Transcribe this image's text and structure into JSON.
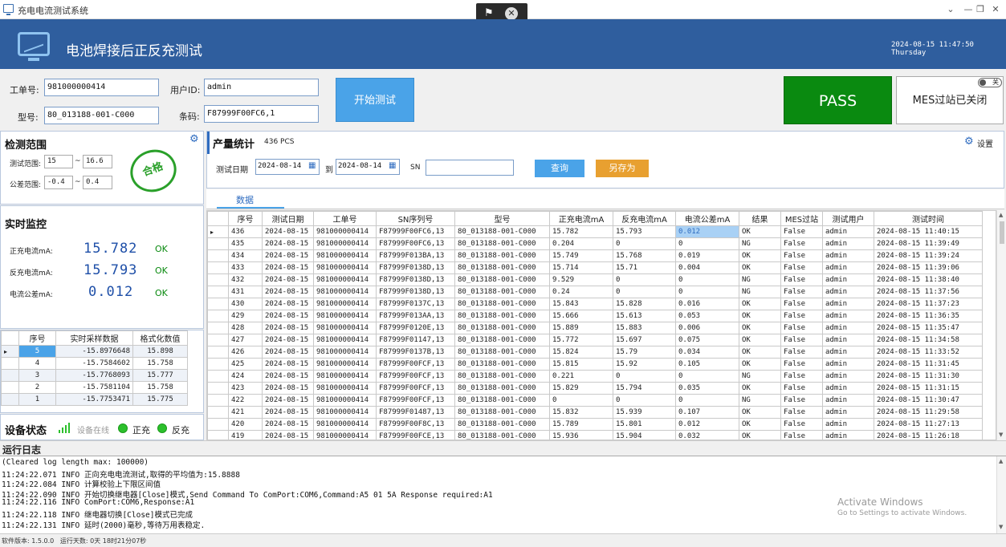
{
  "window": {
    "title": "充电电流测试系统"
  },
  "header": {
    "title": "电池焊接后正反充测试",
    "datetime": "2024-08-15 11:47:50 Thursday"
  },
  "form": {
    "work_order_label": "工单号:",
    "work_order": "981000000414",
    "model_label": "型号:",
    "model": "80_013188-001-C000",
    "user_label": "用户ID:",
    "user": "admin",
    "barcode_label": "条码:",
    "barcode": "F87999F00FC6,1",
    "start_button": "开始测试",
    "result": "PASS",
    "mes_status": "MES过站已关闭",
    "mes_toggle": "关"
  },
  "range": {
    "title": "检测范围",
    "test_range_label": "测试范围:",
    "test_min": "15",
    "test_max": "16.6",
    "tol_label": "公差范围:",
    "tol_min": "-0.4",
    "tol_max": "0.4",
    "stamp_text": "合格"
  },
  "monitor": {
    "title": "实时监控",
    "rows": [
      {
        "label": "正充电流mA:",
        "value": "15.782",
        "status": "OK"
      },
      {
        "label": "反充电流mA:",
        "value": "15.793",
        "status": "OK"
      },
      {
        "label": "电流公差mA:",
        "value": "0.012",
        "status": "OK"
      }
    ]
  },
  "samples": {
    "headers": [
      "序号",
      "实时采样数据",
      "格式化数值"
    ],
    "rows": [
      [
        "5",
        "-15.8976648",
        "15.898"
      ],
      [
        "4",
        "-15.7584602",
        "15.758"
      ],
      [
        "3",
        "-15.7768093",
        "15.777"
      ],
      [
        "2",
        "-15.7581104",
        "15.758"
      ],
      [
        "1",
        "-15.7753471",
        "15.775"
      ]
    ]
  },
  "device": {
    "title": "设备状态",
    "online": "设备在线",
    "forward": "正充",
    "reverse": "反充"
  },
  "stats": {
    "title": "产量统计",
    "count": "436 PCS",
    "settings": "设置",
    "date_label": "测试日期",
    "date_from": "2024-08-14",
    "to_label": "到",
    "date_to": "2024-08-14",
    "sn_label": "SN",
    "sn_value": "",
    "query_button": "查询",
    "save_button": "另存为",
    "tab": "数据"
  },
  "grid": {
    "headers": [
      "序号",
      "测试日期",
      "工单号",
      "SN序列号",
      "型号",
      "正充电流mA",
      "反充电流mA",
      "电流公差mA",
      "结果",
      "MES过站",
      "测试用户",
      "测试时间"
    ],
    "rows": [
      [
        "436",
        "2024-08-15",
        "981000000414",
        "F87999F00FC6,13",
        "80_013188-001-C000",
        "15.782",
        "15.793",
        "0.012",
        "OK",
        "False",
        "admin",
        "2024-08-15 11:40:15"
      ],
      [
        "435",
        "2024-08-15",
        "981000000414",
        "F87999F00FC6,13",
        "80_013188-001-C000",
        "0.204",
        "0",
        "0",
        "NG",
        "False",
        "admin",
        "2024-08-15 11:39:49"
      ],
      [
        "434",
        "2024-08-15",
        "981000000414",
        "F87999F013BA,13",
        "80_013188-001-C000",
        "15.749",
        "15.768",
        "0.019",
        "OK",
        "False",
        "admin",
        "2024-08-15 11:39:24"
      ],
      [
        "433",
        "2024-08-15",
        "981000000414",
        "F87999F0138D,13",
        "80_013188-001-C000",
        "15.714",
        "15.71",
        "0.004",
        "OK",
        "False",
        "admin",
        "2024-08-15 11:39:06"
      ],
      [
        "432",
        "2024-08-15",
        "981000000414",
        "F87999F0138D,13",
        "80_013188-001-C000",
        "9.529",
        "0",
        "0",
        "NG",
        "False",
        "admin",
        "2024-08-15 11:38:40"
      ],
      [
        "431",
        "2024-08-15",
        "981000000414",
        "F87999F0138D,13",
        "80_013188-001-C000",
        "0.24",
        "0",
        "0",
        "NG",
        "False",
        "admin",
        "2024-08-15 11:37:56"
      ],
      [
        "430",
        "2024-08-15",
        "981000000414",
        "F87999F0137C,13",
        "80_013188-001-C000",
        "15.843",
        "15.828",
        "0.016",
        "OK",
        "False",
        "admin",
        "2024-08-15 11:37:23"
      ],
      [
        "429",
        "2024-08-15",
        "981000000414",
        "F87999F013AA,13",
        "80_013188-001-C000",
        "15.666",
        "15.613",
        "0.053",
        "OK",
        "False",
        "admin",
        "2024-08-15 11:36:35"
      ],
      [
        "428",
        "2024-08-15",
        "981000000414",
        "F87999F0120E,13",
        "80_013188-001-C000",
        "15.889",
        "15.883",
        "0.006",
        "OK",
        "False",
        "admin",
        "2024-08-15 11:35:47"
      ],
      [
        "427",
        "2024-08-15",
        "981000000414",
        "F87999F01147,13",
        "80_013188-001-C000",
        "15.772",
        "15.697",
        "0.075",
        "OK",
        "False",
        "admin",
        "2024-08-15 11:34:58"
      ],
      [
        "426",
        "2024-08-15",
        "981000000414",
        "F87999F0137B,13",
        "80_013188-001-C000",
        "15.824",
        "15.79",
        "0.034",
        "OK",
        "False",
        "admin",
        "2024-08-15 11:33:52"
      ],
      [
        "425",
        "2024-08-15",
        "981000000414",
        "F87999F00FCF,13",
        "80_013188-001-C000",
        "15.815",
        "15.92",
        "0.105",
        "OK",
        "False",
        "admin",
        "2024-08-15 11:31:45"
      ],
      [
        "424",
        "2024-08-15",
        "981000000414",
        "F87999F00FCF,13",
        "80_013188-001-C000",
        "0.221",
        "0",
        "0",
        "NG",
        "False",
        "admin",
        "2024-08-15 11:31:30"
      ],
      [
        "423",
        "2024-08-15",
        "981000000414",
        "F87999F00FCF,13",
        "80_013188-001-C000",
        "15.829",
        "15.794",
        "0.035",
        "OK",
        "False",
        "admin",
        "2024-08-15 11:31:15"
      ],
      [
        "422",
        "2024-08-15",
        "981000000414",
        "F87999F00FCF,13",
        "80_013188-001-C000",
        "0",
        "0",
        "0",
        "NG",
        "False",
        "admin",
        "2024-08-15 11:30:47"
      ],
      [
        "421",
        "2024-08-15",
        "981000000414",
        "F87999F01487,13",
        "80_013188-001-C000",
        "15.832",
        "15.939",
        "0.107",
        "OK",
        "False",
        "admin",
        "2024-08-15 11:29:58"
      ],
      [
        "420",
        "2024-08-15",
        "981000000414",
        "F87999F00F8C,13",
        "80_013188-001-C000",
        "15.789",
        "15.801",
        "0.012",
        "OK",
        "False",
        "admin",
        "2024-08-15 11:27:13"
      ],
      [
        "419",
        "2024-08-15",
        "981000000414",
        "F87999F00FCE,13",
        "80_013188-001-C000",
        "15.936",
        "15.904",
        "0.032",
        "OK",
        "False",
        "admin",
        "2024-08-15 11:26:18"
      ]
    ]
  },
  "log": {
    "title": "运行日志",
    "lines": [
      "(Cleared log length max: 100000)",
      "11:24:22.071  INFO 正向充电电流测试,取得的平均值为:15.8888",
      "11:24:22.084  INFO 计算校验上下限区间值",
      "11:24:22.090  INFO 开始切换继电器[Close]模式,Send Command To ComPort:COM6,Command:A5 01 5A Response required:A1",
      "11:24:22.116  INFO ComPort:COM6,Response:A1",
      "11:24:22.118  INFO 继电器切换[Close]模式已完成",
      "11:24:22.131  INFO 延时(2000)毫秒,等待万用表稳定."
    ]
  },
  "status_bar": {
    "version": "软件版本: 1.5.0.0",
    "runtime": "运行天数: 0天 18时21分07秒"
  },
  "watermark": {
    "line1": "Activate Windows",
    "line2": "Go to Settings to activate Windows."
  },
  "colors": {
    "header": "#2f5e9e",
    "pass": "#0a8a10",
    "start": "#4aa3e8",
    "query": "#4aa3e8",
    "save": "#e8a030"
  }
}
